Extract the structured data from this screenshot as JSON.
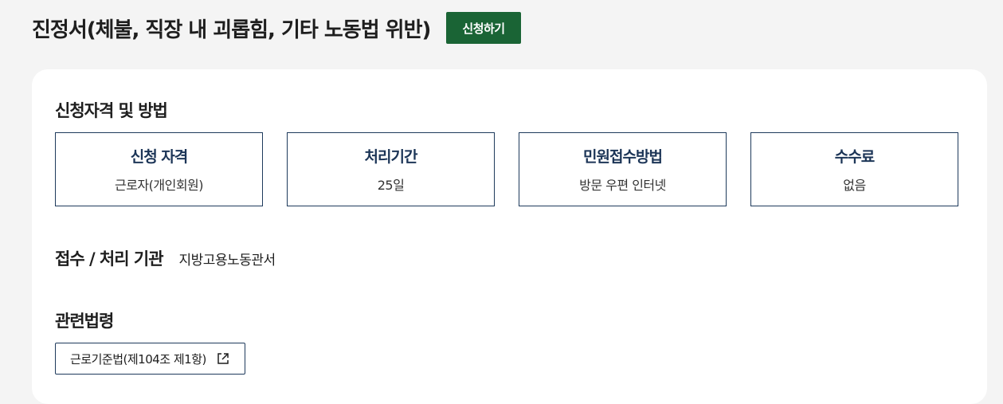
{
  "page": {
    "title": "진정서(체불, 직장 내 괴롭힘, 기타 노동법 위반)",
    "apply_button_label": "신청하기"
  },
  "qualification": {
    "section_title": "신청자격 및 방법",
    "boxes": [
      {
        "label": "신청 자격",
        "value": "근로자(개인회원)"
      },
      {
        "label": "처리기간",
        "value": "25일"
      },
      {
        "label": "민원접수방법",
        "value": "방문 우편 인터넷"
      },
      {
        "label": "수수료",
        "value": "없음"
      }
    ]
  },
  "agency": {
    "label": "접수 / 처리 기관",
    "value": "지방고용노동관서"
  },
  "law": {
    "section_title": "관련법령",
    "link_label": "근로기준법(제104조 제1항)",
    "link_icon": "external-link-icon"
  },
  "colors": {
    "primary_button": "#1a6435",
    "box_border": "#1e3a5c",
    "box_label": "#1c3557",
    "page_background": "#f4f4f4",
    "card_background": "#ffffff"
  }
}
